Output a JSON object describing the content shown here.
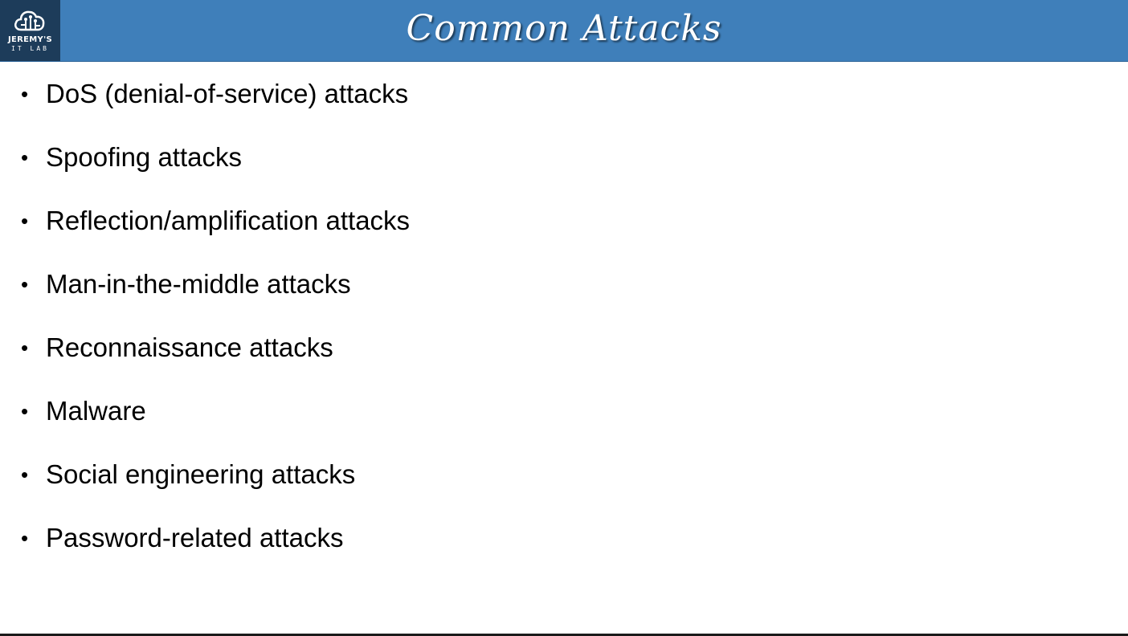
{
  "logo": {
    "line1": "JEREMY'S",
    "line2": "IT LAB",
    "icon": "cloud-circuit-icon"
  },
  "header": {
    "title": "Common Attacks",
    "background": "#3f7fba"
  },
  "bullets": [
    "DoS (denial-of-service) attacks",
    "Spoofing attacks",
    "Reflection/amplification attacks",
    "Man-in-the-middle attacks",
    "Reconnaissance attacks",
    "Malware",
    "Social engineering attacks",
    "Password-related attacks"
  ],
  "bullet_symbol": "•"
}
